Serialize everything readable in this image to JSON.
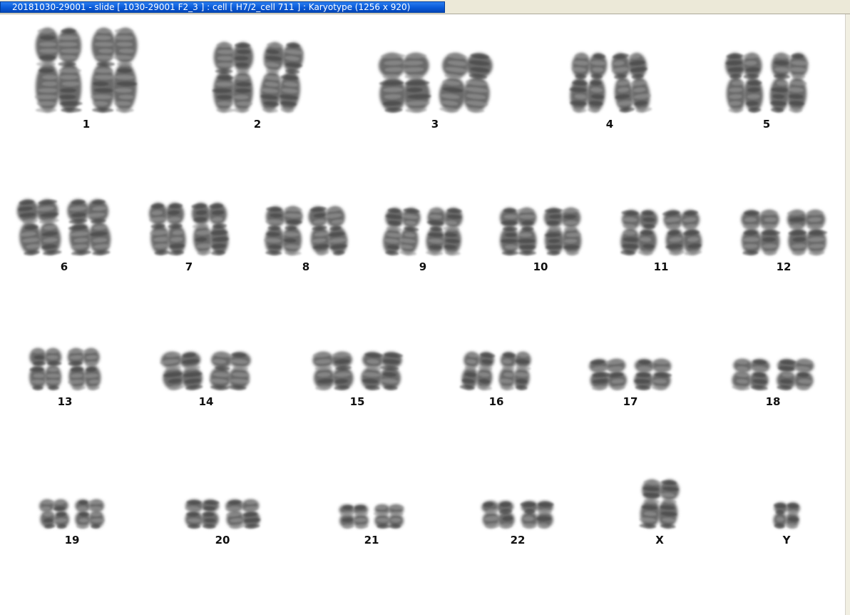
{
  "window": {
    "title": "20181030-29001 - slide [ 1030-29001 F2_3 ] : cell [ H7/2_cell 711 ] : Karyotype  (1256 x 920)"
  },
  "karyotype": {
    "pairs": [
      {
        "label": "1"
      },
      {
        "label": "2"
      },
      {
        "label": "3"
      },
      {
        "label": "4"
      },
      {
        "label": "5"
      },
      {
        "label": "6"
      },
      {
        "label": "7"
      },
      {
        "label": "8"
      },
      {
        "label": "9"
      },
      {
        "label": "10"
      },
      {
        "label": "11"
      },
      {
        "label": "12"
      },
      {
        "label": "13"
      },
      {
        "label": "14"
      },
      {
        "label": "15"
      },
      {
        "label": "16"
      },
      {
        "label": "17"
      },
      {
        "label": "18"
      },
      {
        "label": "19"
      },
      {
        "label": "20"
      },
      {
        "label": "21"
      },
      {
        "label": "22"
      },
      {
        "label": "X"
      },
      {
        "label": "Y"
      }
    ]
  }
}
